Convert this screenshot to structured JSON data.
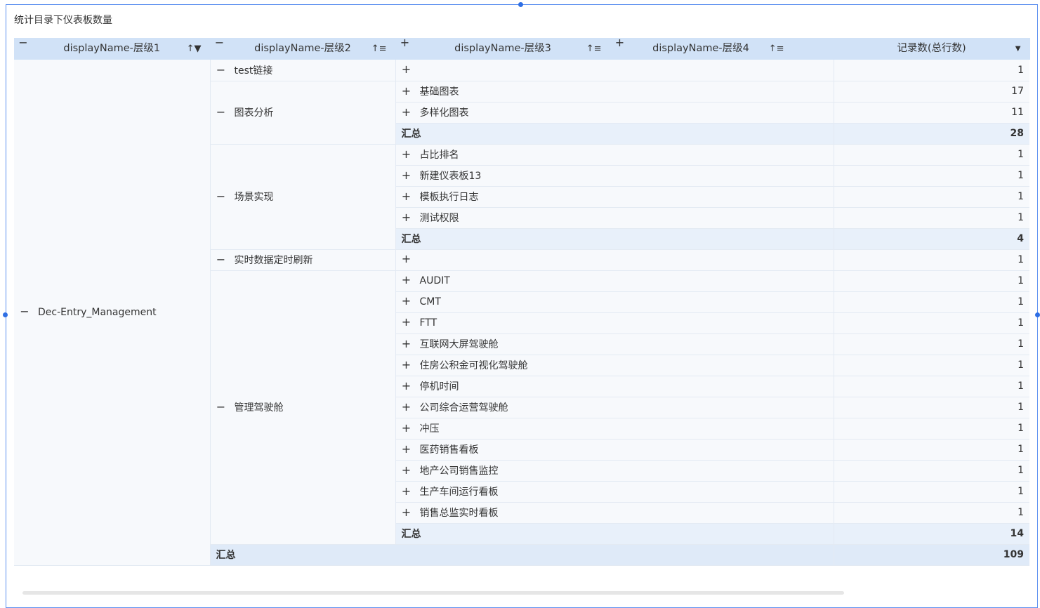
{
  "title": "统计目录下仪表板数量",
  "headers": {
    "col1": "displayName-层级1",
    "col2": "displayName-层级2",
    "col3": "displayName-层级3",
    "col4": "displayName-层级4",
    "col5": "记录数(总行数)"
  },
  "icons": {
    "collapse": "−",
    "expand": "+",
    "sort_asc": "↑↓",
    "dropdown": "▼"
  },
  "level1": "Dec-Entry_Management",
  "subtotal_label": "汇总",
  "groups": {
    "g1": {
      "name": "test链接",
      "rows": [
        {
          "label": "",
          "value": "1"
        }
      ]
    },
    "g2": {
      "name": "图表分析",
      "rows": [
        {
          "label": "基础图表",
          "value": "17"
        },
        {
          "label": "多样化图表",
          "value": "11"
        }
      ],
      "total": "28"
    },
    "g3": {
      "name": "场景实现",
      "rows": [
        {
          "label": "占比排名",
          "value": "1"
        },
        {
          "label": "新建仪表板13",
          "value": "1"
        },
        {
          "label": "模板执行日志",
          "value": "1"
        },
        {
          "label": "测试权限",
          "value": "1"
        }
      ],
      "total": "4"
    },
    "g4": {
      "name": "实时数据定时刷新",
      "rows": [
        {
          "label": "",
          "value": "1"
        }
      ]
    },
    "g5": {
      "name": "管理驾驶舱",
      "rows": [
        {
          "label": "AUDIT",
          "value": "1"
        },
        {
          "label": "CMT",
          "value": "1"
        },
        {
          "label": "FTT",
          "value": "1"
        },
        {
          "label": "互联网大屏驾驶舱",
          "value": "1"
        },
        {
          "label": "住房公积金可视化驾驶舱",
          "value": "1"
        },
        {
          "label": "停机时间",
          "value": "1"
        },
        {
          "label": "公司综合运营驾驶舱",
          "value": "1"
        },
        {
          "label": "冲压",
          "value": "1"
        },
        {
          "label": "医药销售看板",
          "value": "1"
        },
        {
          "label": "地产公司销售监控",
          "value": "1"
        },
        {
          "label": "生产车间运行看板",
          "value": "1"
        },
        {
          "label": "销售总监实时看板",
          "value": "1"
        }
      ],
      "total": "14"
    }
  },
  "grand_total": "109"
}
